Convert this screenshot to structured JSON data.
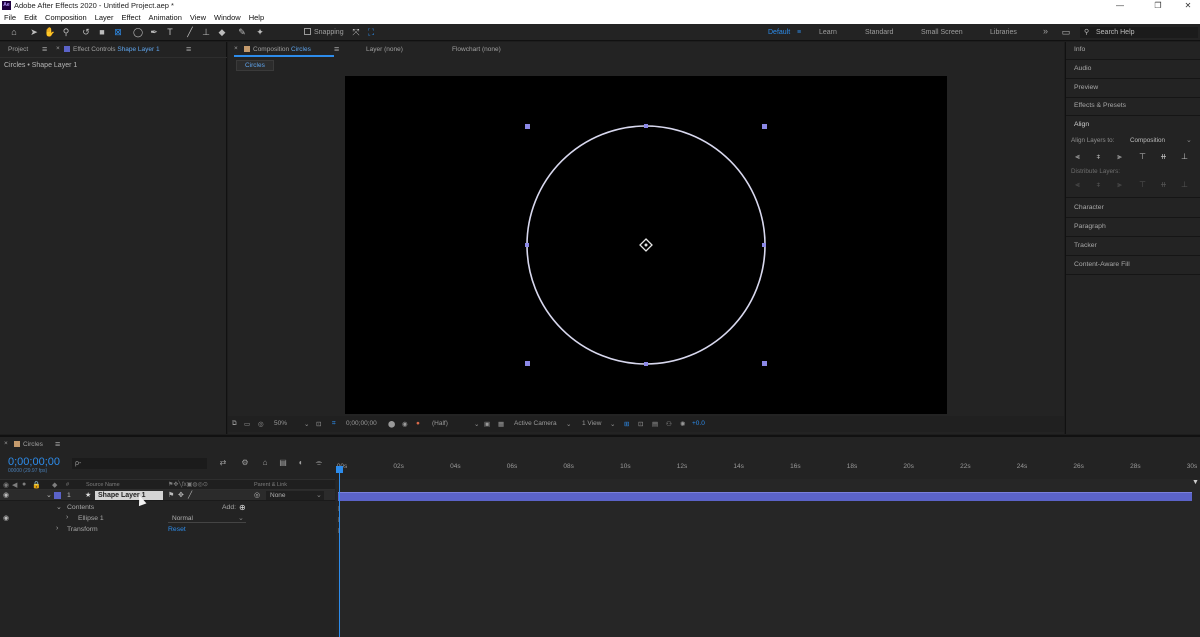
{
  "window": {
    "title": "Adobe After Effects 2020 - Untitled Project.aep *",
    "logo_text": "Ae",
    "controls": [
      "—",
      "❐",
      "✕"
    ]
  },
  "menu": [
    "File",
    "Edit",
    "Composition",
    "Layer",
    "Effect",
    "Animation",
    "View",
    "Window",
    "Help"
  ],
  "toolbar": {
    "snapping_label": "Snapping",
    "workspaces": [
      "Default",
      "≡",
      "Learn",
      "Standard",
      "Small Screen",
      "Libraries"
    ],
    "overflow": "»",
    "search_help_placeholder": "Search Help"
  },
  "left_panel": {
    "tab_project": "Project",
    "tab_effect_controls": "Effect Controls",
    "tab_effect_controls_target": "Shape Layer 1",
    "menu_glyph": "≡",
    "subheader": "Circles • Shape Layer 1"
  },
  "comp_panel": {
    "tab_label": "Composition",
    "tab_target": "Circles",
    "tab_layer": "Layer (none)",
    "tab_flowchart": "Flowchart (none)",
    "breadcrumb": "Circles",
    "footer": {
      "zoom": "50%",
      "timecode": "0;00;00;00",
      "resolution": "(Half)",
      "camera": "Active Camera",
      "views": "1 View",
      "exposure": "+0.0"
    }
  },
  "right_panel": {
    "items": [
      "Info",
      "Audio",
      "Preview",
      "Effects & Presets"
    ],
    "align_title": "Align",
    "align_layers_to_label": "Align Layers to:",
    "align_layers_to_value": "Composition",
    "distribute_label": "Distribute Layers:",
    "items_below": [
      "Character",
      "Paragraph",
      "Tracker",
      "Content-Aware Fill"
    ]
  },
  "timeline": {
    "comp_name": "Circles",
    "timecode": "0;00;00;00",
    "fps_text": "00000 (29.97 fps)",
    "search_icon": "ρ-",
    "col_source_name": "Source Name",
    "col_parent_link": "Parent & Link",
    "layer": {
      "number": "1",
      "name": "Shape Layer 1",
      "parent": "None"
    },
    "contents_label": "Contents",
    "add_label": "Add:",
    "ellipse_label": "Ellipse 1",
    "ellipse_mode": "Normal",
    "transform_label": "Transform",
    "reset_label": "Reset",
    "ruler_ticks": [
      "00s",
      "02s",
      "04s",
      "06s",
      "08s",
      "10s",
      "12s",
      "14s",
      "16s",
      "18s",
      "20s",
      "22s",
      "24s",
      "26s",
      "28s",
      "30s"
    ]
  },
  "colors": {
    "accent": "#2d8ceb",
    "layer_bar": "#5b63c8",
    "handle": "#8b88e6",
    "circle_stroke": "#d8d8ee"
  },
  "icons": [
    "home-icon",
    "selection-tool-icon",
    "hand-tool-icon",
    "zoom-tool-icon",
    "rotate-tool-icon",
    "camera-tool-icon",
    "pan-behind-icon",
    "ellipse-tool-icon",
    "pen-tool-icon",
    "type-tool-icon",
    "brush-tool-icon",
    "clone-stamp-icon",
    "eraser-icon",
    "roto-brush-icon",
    "puppet-pin-icon"
  ]
}
